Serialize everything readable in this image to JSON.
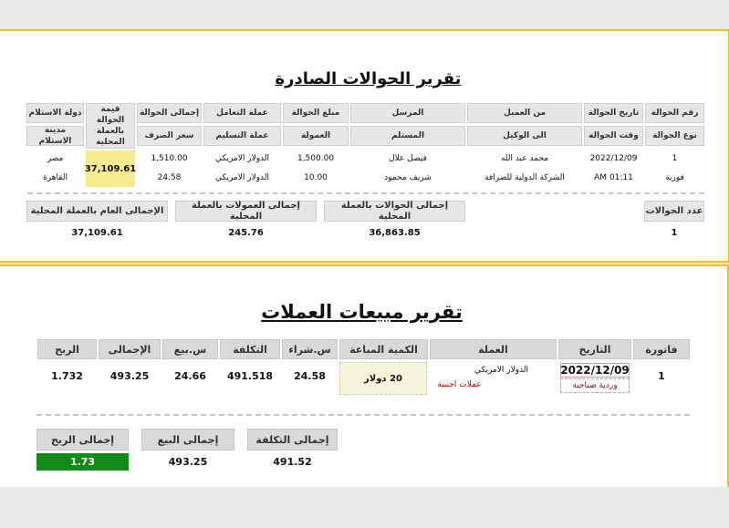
{
  "transfers": {
    "title": "تقرير الحوالات الصادرة",
    "header_row1": [
      "رقم الحوالة",
      "تاريخ الحوالة",
      "من العميل",
      "المرسل",
      "مبلغ الحوالة",
      "عملة التعامل",
      "إجمالى الحوالة",
      "قيمة الحوالة بالعملة المحلية",
      "دولة الاستلام"
    ],
    "header_row2": [
      "نوع الحوالة",
      "وقت الحوالة",
      "الى الوكيل",
      "المستلم",
      "العمولة",
      "عملة التسليم",
      "سعر الصرف",
      "",
      "مدينة الاستلام"
    ],
    "row1": {
      "number": "1",
      "date": "2022/12/09",
      "from_client": "محمد عبد الله",
      "sender": "فيصل علال",
      "amount": "1,500.00",
      "deal_currency": "الدولار الامريكي",
      "total": "1,510.00",
      "local_value": "37,109.61",
      "country": "مصر"
    },
    "row2": {
      "type": "فورية",
      "time": "01:11 AM",
      "agent": "الشركة الدولية للصرافة",
      "receiver": "شريف محمود",
      "commission": "10.00",
      "delivery_currency": "الدولار الامريكي",
      "rate": "24.58",
      "city": "القاهرة"
    },
    "summary_headers": {
      "count": "عدد الحوالات",
      "total_transfers": "إجمالى الحوالات بالعملة المحلية",
      "total_commissions": "إجمالى العمولات بالعملة المحلية",
      "grand_total": "الإجمالى العام بالعملة المحلية"
    },
    "summary_values": {
      "count": "1",
      "total_transfers": "36,863.85",
      "total_commissions": "245.76",
      "grand_total": "37,109.61"
    }
  },
  "sales": {
    "title": "تقرير مبيعات العملات",
    "headers": {
      "invoice": "فاتورة",
      "date": "التاريخ",
      "currency": "العملة",
      "quantity": "الكمية المباعة",
      "buy": "س.شراء",
      "cost": "التكلفة",
      "sell": "س.بيع",
      "total": "الإجمالى",
      "profit": "الربح"
    },
    "row": {
      "invoice": "1",
      "date": "2022/12/09",
      "shift": "وردية صباحية",
      "currency": "الدولار الامريكي",
      "category": "عملات اجنبية",
      "quantity": "20 دولار",
      "buy": "24.58",
      "cost": "491.518",
      "sell": "24.66",
      "total": "493.25",
      "profit": "1.732"
    },
    "totals_headers": {
      "cost": "إجمالى التكلفة",
      "sales": "إجمالى البيع",
      "profit": "إجمالى الربح"
    },
    "totals_values": {
      "cost": "491.52",
      "sales": "493.25",
      "profit": "1.73"
    }
  },
  "colors": {
    "accent": "#f2c300",
    "highlight": "#f7e98e",
    "profit_bg": "#118a1a",
    "category_red": "#c00000"
  }
}
